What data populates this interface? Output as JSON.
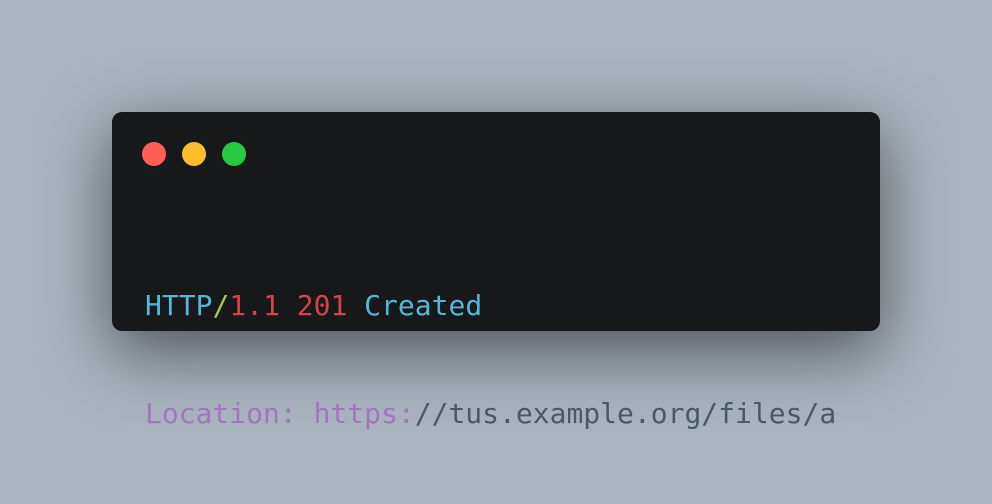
{
  "window": {
    "controls": [
      {
        "name": "close",
        "color": "#ff5f56"
      },
      {
        "name": "minimize",
        "color": "#ffbd2e"
      },
      {
        "name": "maximize",
        "color": "#27c93f"
      }
    ]
  },
  "code": {
    "line1": {
      "protocol": "HTTP",
      "slash": "/",
      "version": "1.1",
      "space1": " ",
      "status": "201",
      "space2": " ",
      "reason": "Created"
    },
    "line2": {
      "header": "Location:",
      "space": " ",
      "scheme": "https:",
      "rest": "//tus.example.org/files/a"
    }
  },
  "colors": {
    "cyan": "#56b6d8",
    "red": "#d4434a",
    "green": "#a9c65a",
    "purple": "#a474c0",
    "gray": "#4b5963"
  }
}
